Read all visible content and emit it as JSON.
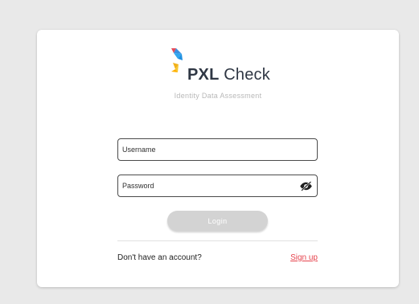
{
  "brand": {
    "strong": "PXL",
    "light": " Check",
    "tagline": "Identity Data Assessment",
    "colors": {
      "blue": "#1f8fe0",
      "red": "#e64b58",
      "yellow": "#f2b11a",
      "text": "#2f3744"
    }
  },
  "form": {
    "username_placeholder": "Username",
    "password_placeholder": "Password",
    "password_toggle_icon": "eye-off-icon",
    "login_label": "Login",
    "login_color": "#d3d3d3"
  },
  "signup": {
    "prompt": "Don't have an account?",
    "link_label": "Sign up",
    "link_color": "#e6434d"
  }
}
